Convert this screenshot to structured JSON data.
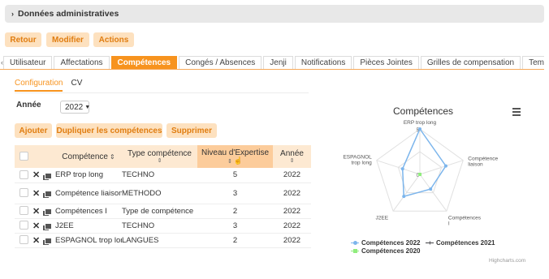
{
  "admin_section": {
    "chevron": "›",
    "title": "Données administratives"
  },
  "actions": {
    "back": "Retour",
    "edit": "Modifier",
    "actions": "Actions"
  },
  "tabs": {
    "scroll_left": "‹",
    "items": [
      "Utilisateur",
      "Affectations",
      "Compétences",
      "Congés / Absences",
      "Jenji",
      "Notifications",
      "Pièces Jointes",
      "Grilles de compensation",
      "Temps de tr"
    ],
    "active": "Compétences"
  },
  "subtabs": [
    "Configuration",
    "CV"
  ],
  "filter": {
    "label": "Année",
    "value": "2022"
  },
  "toolbar": {
    "add": "Ajouter",
    "duplicate": "Dupliquer les compétences",
    "delete": "Supprimer"
  },
  "table": {
    "headers": {
      "competence": "Compétence",
      "type": "Type compétence",
      "level": "Niveau d'Expertise",
      "year": "Année"
    },
    "rows": [
      {
        "competence": "ERP trop long",
        "type": "TECHNO",
        "level": "5",
        "year": "2022"
      },
      {
        "competence": "Compétence liaison",
        "type": "METHODO",
        "level": "3",
        "year": "2022"
      },
      {
        "competence": "Compétences I",
        "type": "Type de compétence",
        "level": "2",
        "year": "2022"
      },
      {
        "competence": "J2EE",
        "type": "TECHNO",
        "level": "3",
        "year": "2022"
      },
      {
        "competence": "ESPAGNOL trop long",
        "type": "LANGUES",
        "level": "2",
        "year": "2022"
      }
    ]
  },
  "icons": {
    "delete": "close-icon",
    "duplicate": "copy-icon",
    "menu": "hamburger-menu-icon",
    "sort": "sort-icon",
    "cursor": "hand-cursor-icon"
  },
  "chart_data": {
    "type": "radar",
    "title": "Compétences",
    "categories": [
      "ERP trop long",
      "Compétence liaison",
      "Compétences I",
      "J2EE",
      "ESPAGNOL trop long"
    ],
    "ylim": [
      0,
      5
    ],
    "tick_labels": [
      "0",
      "5"
    ],
    "series": [
      {
        "name": "Compétences 2022",
        "values": [
          5,
          3,
          2,
          3,
          2
        ],
        "color": "#7cb5ec"
      },
      {
        "name": "Compétences 2021",
        "values": [
          0,
          0,
          0,
          0,
          0
        ],
        "color": "#434348"
      },
      {
        "name": "Compétences 2020",
        "values": [
          0,
          0,
          0,
          0,
          0
        ],
        "color": "#90ed7d"
      }
    ],
    "legend": "bottom",
    "credits": "Highcharts.com"
  },
  "colors": {
    "accent": "#f7931e",
    "button_bg": "#fde1bf",
    "header_bg": "#fde9d2",
    "header_highlight": "#fccc9b"
  }
}
